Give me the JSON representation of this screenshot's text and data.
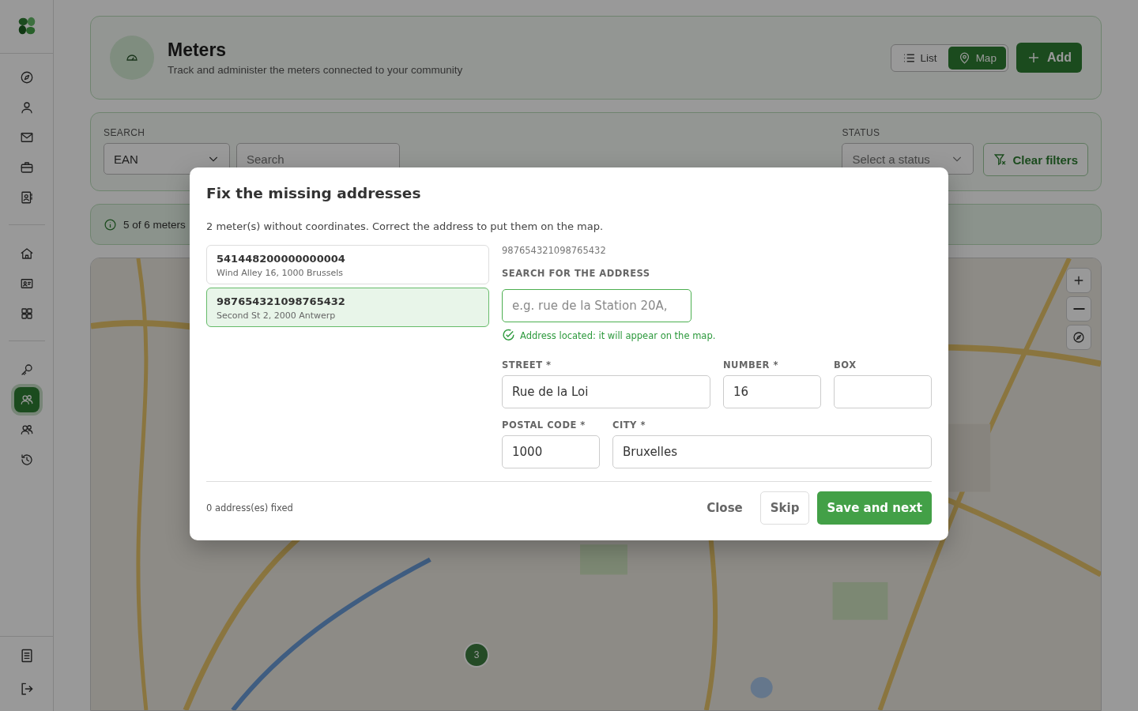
{
  "sidebar": {
    "groups": [
      {
        "items": [
          {
            "selected": false
          },
          {
            "selected": false
          },
          {
            "selected": false
          },
          {
            "selected": false
          },
          {
            "selected": false
          }
        ]
      },
      {
        "items": [
          {
            "selected": false
          },
          {
            "selected": false
          },
          {
            "selected": false
          }
        ]
      },
      {
        "items": [
          {
            "selected": false
          },
          {
            "selected": true
          },
          {
            "selected": false
          },
          {
            "selected": false
          }
        ]
      }
    ]
  },
  "header": {
    "title": "Meters",
    "subtitle": "Track and administer the meters connected to your community",
    "view_toggle": [
      {
        "label": "List",
        "selected": false
      },
      {
        "label": "Map",
        "selected": true
      }
    ],
    "add_button": "Add"
  },
  "filters": {
    "search_label": "SEARCH",
    "search_type": "EAN",
    "search_placeholder": "Search",
    "status_label": "STATUS",
    "status_placeholder": "Select a status",
    "clear_button": "Clear filters"
  },
  "info": "5 of 6 meters",
  "map": {
    "cluster_count": "3"
  },
  "dialog": {
    "title": "Fix the missing addresses",
    "description": "2 meter(s) without coordinates. Correct the address to put them on the map.",
    "meters": [
      {
        "ean": "541448200000000004",
        "address": "Wind Alley 16, 1000 Brussels",
        "selected": false
      },
      {
        "ean": "987654321098765432",
        "address": "Second St 2, 2000 Antwerp",
        "selected": true
      }
    ],
    "current_ean": "987654321098765432",
    "search_label": "SEARCH FOR THE ADDRESS",
    "search_placeholder": "e.g. rue de la Station 20A,",
    "status": "Address located: it will appear on the map.",
    "field_rows": [
      [
        {
          "label": "STREET *",
          "value": "Rue de la Loi"
        },
        {
          "label": "NUMBER *",
          "value": "16"
        },
        {
          "label": "BOX"
        }
      ],
      [
        {
          "label": "POSTAL CODE *",
          "value": "1000"
        },
        {
          "label": "CITY *",
          "value": "Bruxelles"
        }
      ]
    ],
    "fixed_count": "0 address(es) fixed",
    "buttons": [
      {
        "label": "Close",
        "kind": "text"
      },
      {
        "label": "Skip",
        "kind": "outline"
      },
      {
        "label": "Save and next",
        "kind": "primary"
      }
    ]
  }
}
